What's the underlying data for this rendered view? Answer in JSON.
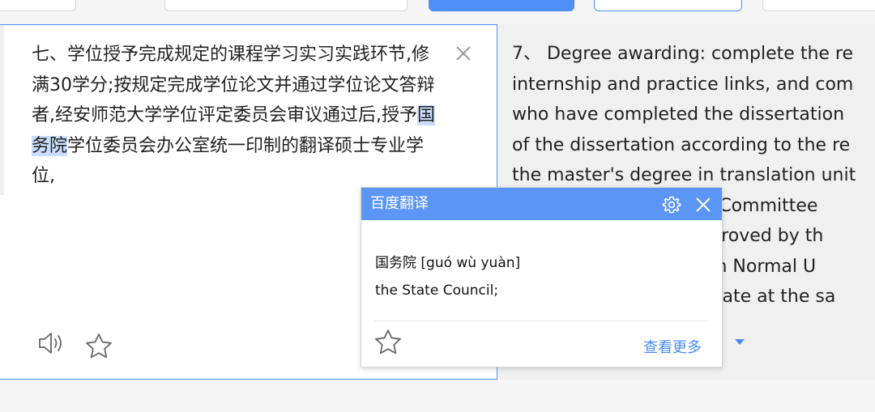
{
  "source": {
    "text_before": "七、学位授予完成规定的课程学习实习实践环节,修满30学分;按规定完成学位论文并通过学位论文答辩者,经安师范大学学位评定委员会审议通过后,授予",
    "text_highlight": "国务院",
    "text_after": "学位委员会办公室统一印制的翻译硕士专业学位,"
  },
  "translation": {
    "lines": [
      "7、 Degree awarding: complete the re",
      "internship and practice links, and com",
      "who have completed the dissertation",
      "of the dissertation according to the re",
      "the master's degree in translation unit",
      "                              ees Committee",
      "                               approved by th",
      "                              of an Normal U",
      "                              rtificate at the sa"
    ]
  },
  "popup": {
    "title": "百度翻译",
    "word": "国务院 [guó wù yuàn]",
    "definition": "the State Council;",
    "more_label": "查看更多"
  },
  "colors": {
    "accent": "#4e8ef7",
    "popup_header": "#5b95f5",
    "highlight": "#c9defd",
    "link": "#4a8bf5"
  },
  "icons": {
    "clear": "close-icon",
    "speaker": "speaker-icon",
    "favorite": "star-icon",
    "settings": "gear-icon",
    "popup_close": "close-icon",
    "more_caret": "caret-down-icon"
  }
}
